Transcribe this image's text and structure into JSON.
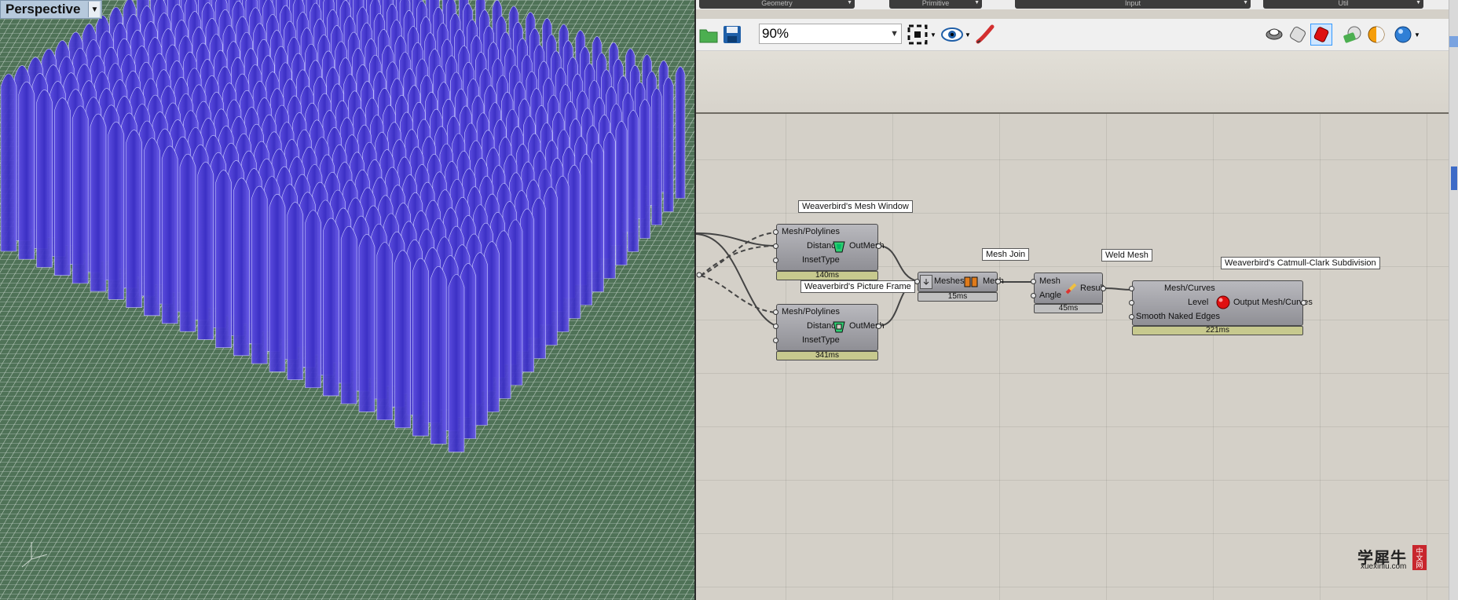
{
  "viewport": {
    "label": "Perspective"
  },
  "tabs": [
    {
      "label": "Geometry"
    },
    {
      "label": "Primitive"
    },
    {
      "label": "Input"
    },
    {
      "label": "Util"
    }
  ],
  "toolbar": {
    "zoom": "90%"
  },
  "components": {
    "mesh_window": {
      "caption": "Weaverbird's Mesh Window",
      "in1": "Mesh/Polylines",
      "in2": "Distance",
      "in3": "InsetType",
      "out": "OutMesh",
      "time": "140ms"
    },
    "picture_frame": {
      "caption": "Weaverbird's Picture Frame",
      "in1": "Mesh/Polylines",
      "in2": "Distance",
      "in3": "InsetType",
      "out": "OutMesh",
      "time": "341ms"
    },
    "mesh_join": {
      "caption": "Mesh Join",
      "in1": "Meshes",
      "out": "Mesh",
      "time": "15ms"
    },
    "weld_mesh": {
      "caption": "Weld Mesh",
      "in1": "Mesh",
      "in2": "Angle",
      "out": "Result",
      "time": "45ms"
    },
    "catmull_clark": {
      "caption": "Weaverbird's Catmull-Clark Subdivision",
      "in1": "Mesh/Curves",
      "in2": "Level",
      "in3": "Smooth Naked Edges",
      "out": "Output Mesh/Curves",
      "time": "221ms"
    }
  },
  "watermark": {
    "text": "学犀牛",
    "url": "xuexiniu.com",
    "badge": "中文网"
  }
}
